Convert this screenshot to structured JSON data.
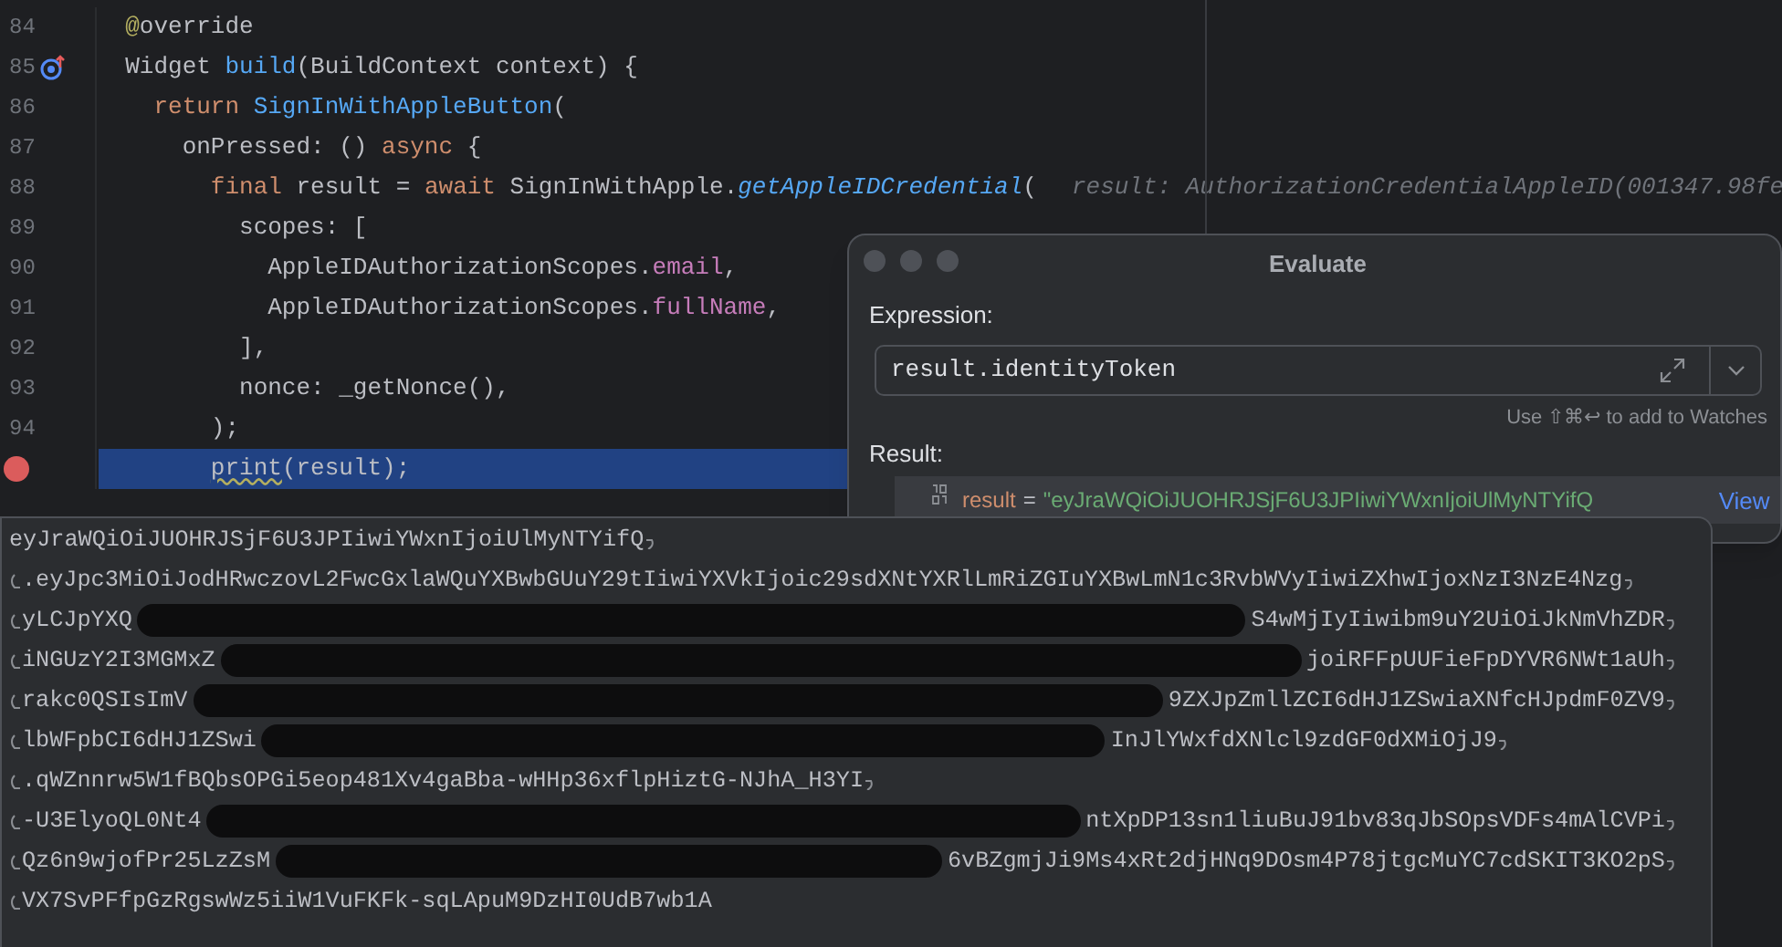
{
  "editor": {
    "lines": [
      {
        "number": "84",
        "current": false,
        "breakpoint": false,
        "override_marker": false,
        "tokens": [
          {
            "text": "  @",
            "kind": "annotation"
          },
          {
            "text": "override",
            "kind": "plain"
          }
        ]
      },
      {
        "number": "85",
        "current": false,
        "breakpoint": false,
        "override_marker": true,
        "tokens": [
          {
            "text": "  Widget ",
            "kind": "plain"
          },
          {
            "text": "build",
            "kind": "function"
          },
          {
            "text": "(BuildContext context) {",
            "kind": "plain"
          }
        ]
      },
      {
        "number": "86",
        "current": false,
        "breakpoint": false,
        "override_marker": false,
        "tokens": [
          {
            "text": "    return ",
            "kind": "keyword"
          },
          {
            "text": "SignInWithAppleButton",
            "kind": "function"
          },
          {
            "text": "(",
            "kind": "plain"
          }
        ]
      },
      {
        "number": "87",
        "current": false,
        "breakpoint": false,
        "override_marker": false,
        "tokens": [
          {
            "text": "      onPressed: () ",
            "kind": "plain"
          },
          {
            "text": "async",
            "kind": "keyword"
          },
          {
            "text": " {",
            "kind": "plain"
          }
        ]
      },
      {
        "number": "88",
        "current": false,
        "breakpoint": false,
        "override_marker": false,
        "tokens": [
          {
            "text": "        final",
            "kind": "keyword"
          },
          {
            "text": " result = ",
            "kind": "plain"
          },
          {
            "text": "await",
            "kind": "keyword"
          },
          {
            "text": " SignInWithApple.",
            "kind": "plain"
          },
          {
            "text": "getAppleIDCredential",
            "kind": "static_call"
          },
          {
            "text": "(",
            "kind": "plain"
          }
        ],
        "hint": "result: AuthorizationCredentialAppleID(001347.98fe"
      },
      {
        "number": "89",
        "current": false,
        "breakpoint": false,
        "override_marker": false,
        "tokens": [
          {
            "text": "          scopes: [",
            "kind": "plain"
          }
        ]
      },
      {
        "number": "90",
        "current": false,
        "breakpoint": false,
        "override_marker": false,
        "tokens": [
          {
            "text": "            AppleIDAuthorizationScopes.",
            "kind": "plain"
          },
          {
            "text": "email",
            "kind": "field"
          },
          {
            "text": ",",
            "kind": "plain"
          }
        ]
      },
      {
        "number": "91",
        "current": false,
        "breakpoint": false,
        "override_marker": false,
        "tokens": [
          {
            "text": "            AppleIDAuthorizationScopes.",
            "kind": "plain"
          },
          {
            "text": "fullName",
            "kind": "field"
          },
          {
            "text": ",",
            "kind": "plain"
          }
        ]
      },
      {
        "number": "92",
        "current": false,
        "breakpoint": false,
        "override_marker": false,
        "tokens": [
          {
            "text": "          ],",
            "kind": "plain"
          }
        ]
      },
      {
        "number": "93",
        "current": false,
        "breakpoint": false,
        "override_marker": false,
        "tokens": [
          {
            "text": "          nonce: _getNonce(),",
            "kind": "plain"
          }
        ]
      },
      {
        "number": "94",
        "current": false,
        "breakpoint": false,
        "override_marker": false,
        "tokens": [
          {
            "text": "        );",
            "kind": "plain"
          }
        ]
      },
      {
        "current": true,
        "breakpoint": true,
        "override_marker": false,
        "tokens": [
          {
            "text": "        print",
            "kind": "warning"
          },
          {
            "text": "(result);",
            "kind": "plain"
          }
        ]
      }
    ]
  },
  "evaluate_dialog": {
    "title": "Evaluate",
    "expression_label": "Expression:",
    "expression": "result.identityToken",
    "watch_hint": "Use ⇧⌘↩ to add to Watches",
    "result_label": "Result:",
    "result": {
      "name": "result",
      "equals": "=",
      "value": "\"eyJraWQiOiJUOHRJSjF6U3JPIiwiYWxnIjoiUlMyNTYifQ",
      "link": "View"
    }
  },
  "value_popup": {
    "lines": [
      {
        "start_mark": false,
        "end_mark": true,
        "segments": [
          "eyJraWQiOiJUOHRJSjF6U3JPIiwiYWxnIjoiUlMyNTYifQ"
        ]
      },
      {
        "start_mark": true,
        "end_mark": true,
        "segments": [
          ".eyJpc3MiOiJodHRwczovL2FwcGxlaWQuYXBwbGUuY29tIiwiYXVkIjoic29sdXNtYXRlLmRiZGIuYXBwLmN1c3RvbWVyIiwiZXhwIjoxNzI3NzE4Nzg"
        ]
      },
      {
        "start_mark": true,
        "end_mark": true,
        "segments": [
          "yLCJpYXQ",
          "S4wMjIyIiwibm9uY2UiOiJkNmVhZDR"
        ]
      },
      {
        "start_mark": true,
        "end_mark": true,
        "segments": [
          "iNGUzY2I3MGMxZ",
          "joiRFFpUUFieFpDYVR6NWt1aUh"
        ]
      },
      {
        "start_mark": true,
        "end_mark": true,
        "segments": [
          "rakc0QSIsImV",
          "9ZXJpZmllZCI6dHJ1ZSwiaXNfcHJpdmF0ZV9"
        ]
      },
      {
        "start_mark": true,
        "end_mark": true,
        "segments": [
          "lbWFpbCI6dHJ1ZSwi",
          "InJlYWxfdXNlcl9zdGF0dXMiOjJ9"
        ]
      },
      {
        "start_mark": true,
        "end_mark": true,
        "segments": [
          ".qWZnnrw5W1fBQbsOPGi5eop481Xv4gaBba-wHHp36xflpHiztG-NJhA_H3YI"
        ]
      },
      {
        "start_mark": true,
        "end_mark": true,
        "segments": [
          "-U3ElyoQL0Nt4",
          "ntXpDP13sn1liuBuJ91bv83qJbSOpsVDFs4mAlCVPi"
        ]
      },
      {
        "start_mark": true,
        "end_mark": true,
        "segments": [
          "Qz6n9wjofPr25LzZsM",
          "6vBZgmjJi9Ms4xRt2djHNq9DOsm4P78jtgcMuYC7cdSKIT3KO2pS"
        ]
      },
      {
        "start_mark": true,
        "end_mark": false,
        "segments": [
          "VX7SvPFfpGzRgswWz5iiW1VuFKFk-sqLApuM9DzHI0UdB7wb1A"
        ]
      }
    ]
  }
}
